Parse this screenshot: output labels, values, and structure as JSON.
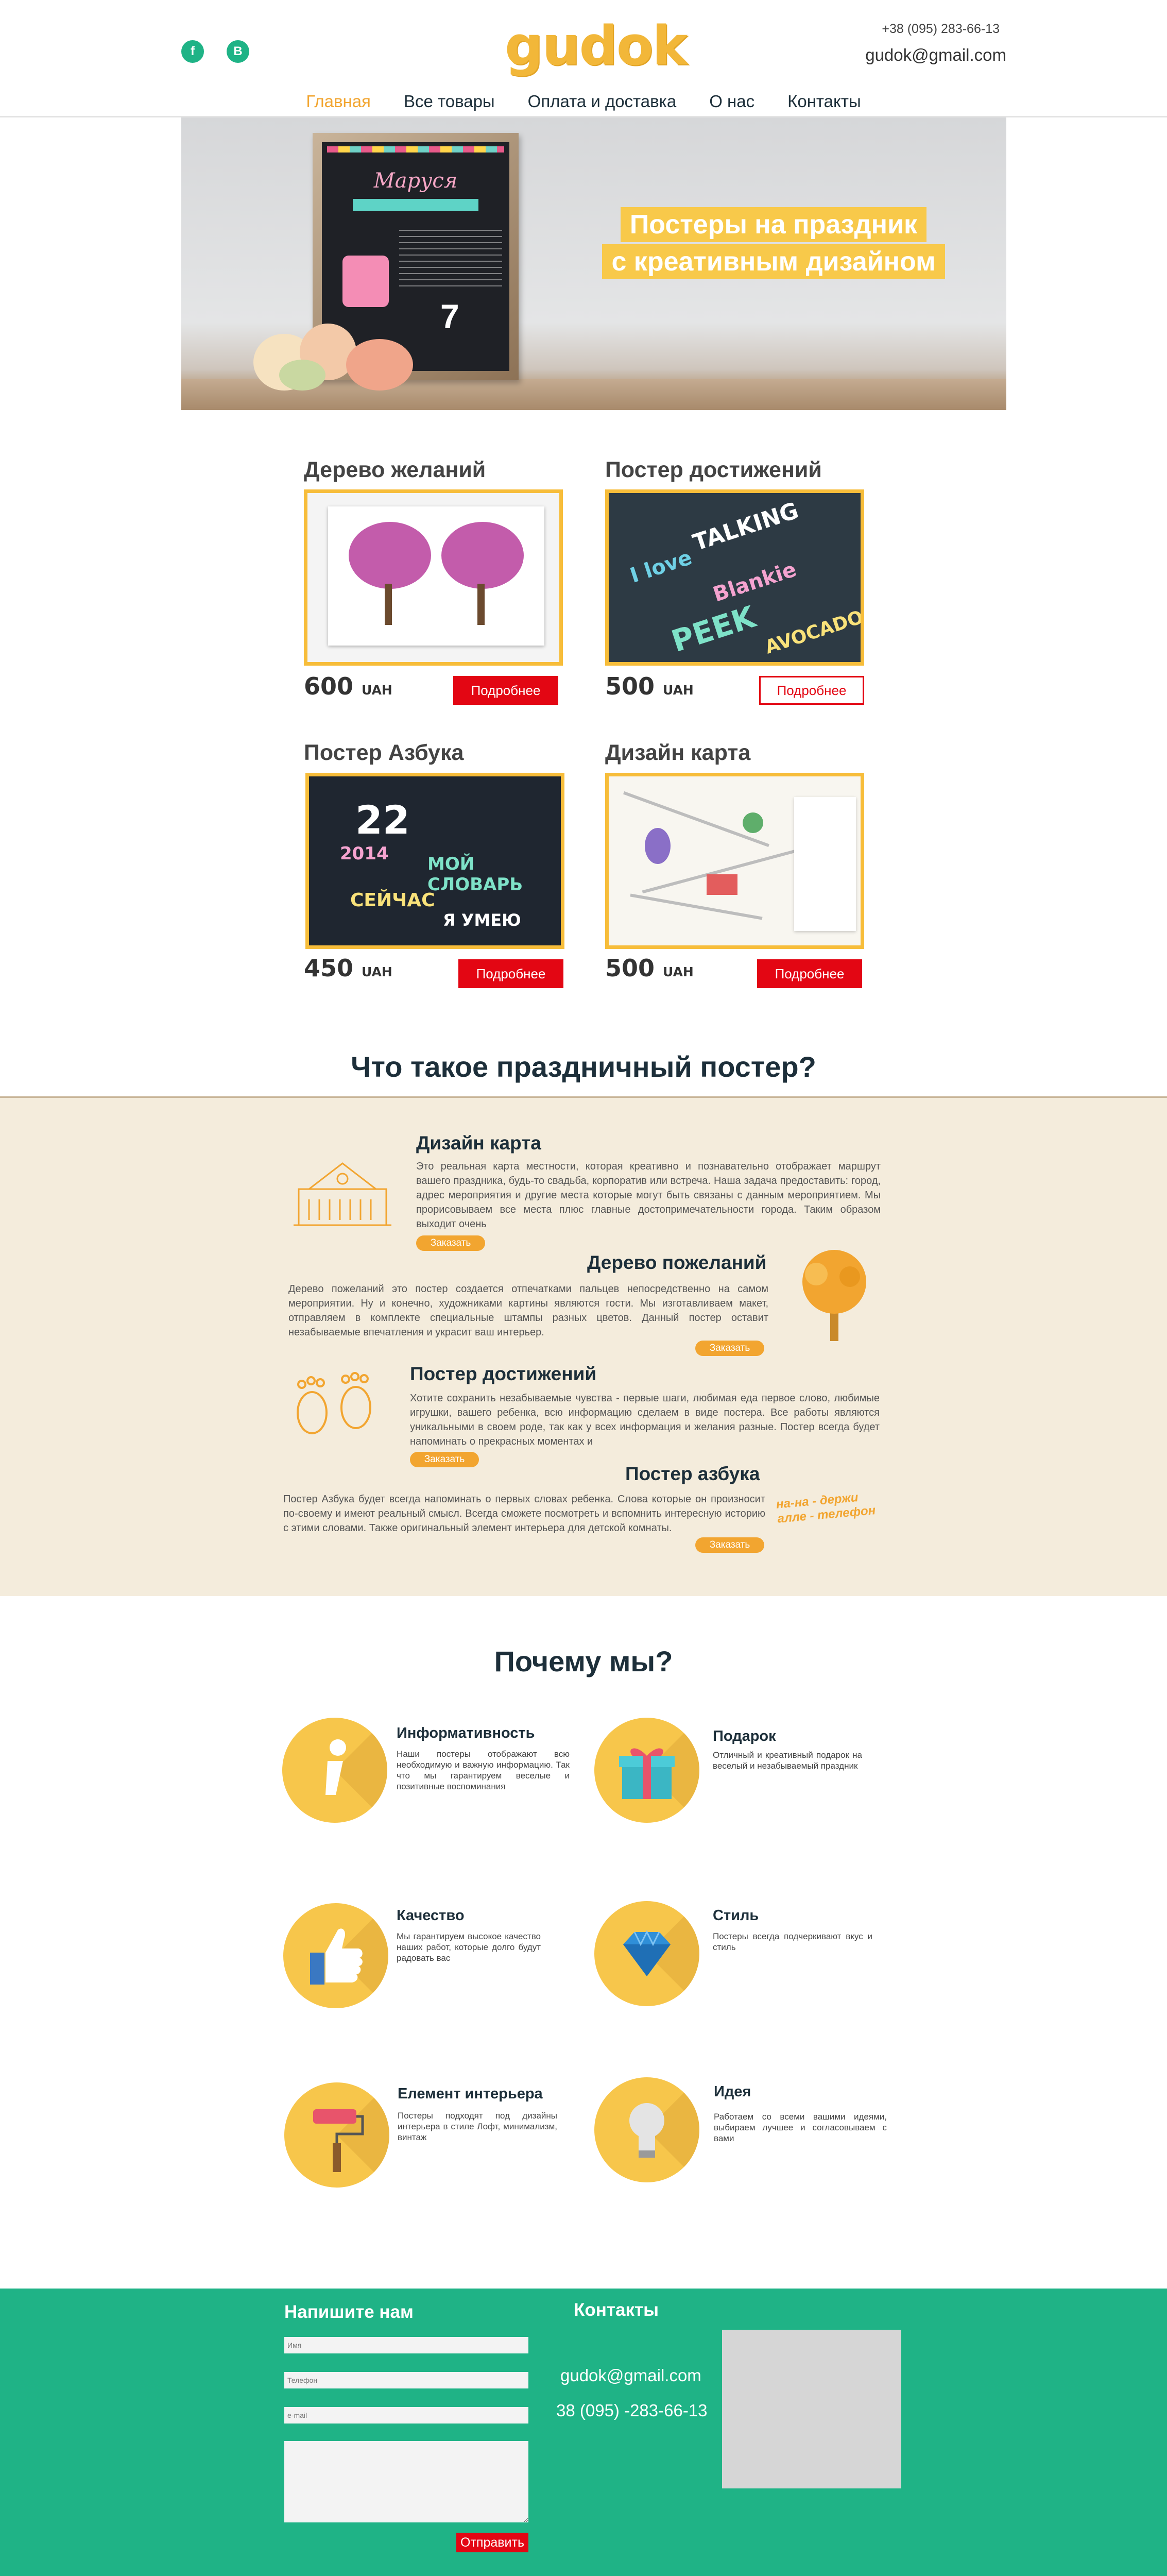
{
  "header": {
    "logo": "gudok",
    "phone": "+38 (095) 283-66-13",
    "email": "gudok@gmail.com",
    "social": [
      "f",
      "B"
    ]
  },
  "nav": [
    "Главная",
    "Все товары",
    "Оплата и доставка",
    "О нас",
    "Контакты"
  ],
  "hero": {
    "title_line1": "Постеры на праздник",
    "title_line2": "с креативным дизайном",
    "poster_name": "Маруся"
  },
  "products": [
    {
      "title": "Дерево желаний",
      "price": "600",
      "currency": "UAH",
      "button": "Подробнее"
    },
    {
      "title": "Постер достижений",
      "price": "500",
      "currency": "UAH",
      "button": "Подробнее"
    },
    {
      "title": "Постер Азбука",
      "price": "450",
      "currency": "UAH",
      "button": "Подробнее"
    },
    {
      "title": "Дизайн карта",
      "price": "500",
      "currency": "UAH",
      "button": "Подробнее"
    }
  ],
  "chalk_words": [
    "TALKING",
    "Blankie",
    "PEEK",
    "AVOCADO",
    "I love"
  ],
  "abc_words": [
    "22",
    "2014",
    "МОЙ СЛОВАРЬ",
    "СЕЙЧАС",
    "Я УМЕЮ"
  ],
  "what_is": {
    "title": "Что такое праздничный постер?",
    "items": [
      {
        "title": "Дизайн карта",
        "text": "Это реальная карта местности, которая креативно и познавательно отображает маршрут вашего праздника, будь-то свадьба, корпоратив или встреча. Наша задача предоставить: город, адрес мероприятия и другие места которые могут быть связаны с данным мероприятием. Мы прорисовываем все места плюс главные достопримечательности города. Таким образом выходит очень",
        "button": "Заказать"
      },
      {
        "title": "Дерево пожеланий",
        "text": "Дерево пожеланий это постер создается отпечатками пальцев непосредственно на самом мероприятии. Ну и конечно, художниками картины являются гости. Мы изготавливаем макет, отправляем в комплекте специальные штампы разных цветов. Данный постер оставит незабываемые впечатления и украсит ваш интерьер.",
        "button": "Заказать"
      },
      {
        "title": "Постер достижений",
        "text": "Хотите сохранить незабываемые чувства - первые шаги, любимая еда первое слово, любимые игрушки, вашего ребенка, всю информацию сделаем в виде постера. Все работы являются уникальными в своем роде, так как у всех информация и желания разные. Постер всегда будет напоминать о прекрасных моментах и",
        "button": "Заказать"
      },
      {
        "title": "Постер азбука",
        "text": "Постер Азбука будет всегда напоминать о первых словах ребенка. Слова которые он произносит по-своему и имеют реальный смысл. Всегда сможете посмотреть и вспомнить интересную историю с этими словами. Также оригинальный элемент интерьера для детской комнаты.",
        "button": "Заказать"
      }
    ],
    "note": "на-на - держи алле - телефон"
  },
  "why": {
    "title": "Почему мы?",
    "items": [
      {
        "title": "Информативность",
        "text": "Наши постеры отображают всю необходимую и важную информацию. Так что мы гарантируем веселые и позитивные воспоминания",
        "icon": "info-icon"
      },
      {
        "title": "Подарок",
        "text": "Отличный и креативный подарок на веселый и незабываемый праздник",
        "icon": "gift-icon"
      },
      {
        "title": "Качество",
        "text": "Мы гарантируем высокое качество наших работ, которые долго будут радовать вас",
        "icon": "thumbs-up-icon"
      },
      {
        "title": "Стиль",
        "text": "Постеры всегда подчеркивают вкус и стиль",
        "icon": "diamond-icon"
      },
      {
        "title": "Елемент интерьера",
        "text": "Постеры подходят под дизайны интерьера в стиле Лофт, минимализм, винтаж",
        "icon": "paint-roller-icon"
      },
      {
        "title": "Идея",
        "text": "Работаем со всеми вашими идеями, выбираем лучшее и согласовываем с вами",
        "icon": "lightbulb-icon"
      }
    ]
  },
  "footer": {
    "write_title": "Напишите нам",
    "contacts_title": "Контакты",
    "name_placeholder": "Имя",
    "phone_placeholder": "Телефон",
    "email_placeholder": "e-mail",
    "send": "Отправить",
    "email": "gudok@gmail.com",
    "phone": "38 (095) -283-66-13"
  }
}
